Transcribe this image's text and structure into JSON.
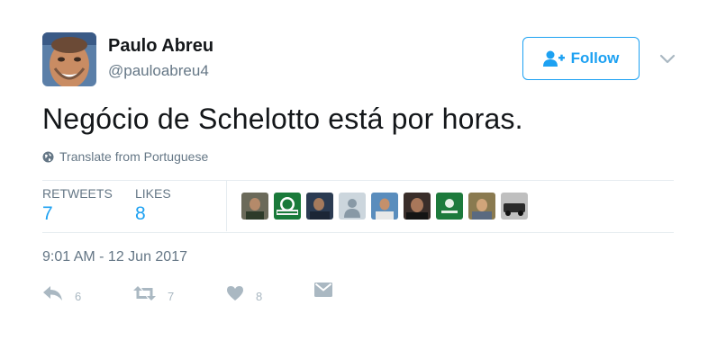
{
  "user": {
    "name": "Paulo Abreu",
    "handle": "@pauloabreu4"
  },
  "follow_button": {
    "label": "Follow"
  },
  "tweet": {
    "text": "Negócio de Schelotto está por horas.",
    "translate_label": "Translate from Portuguese",
    "timestamp": "9:01 AM - 12 Jun 2017"
  },
  "stats": {
    "retweets_label": "RETWEETS",
    "retweets_value": "7",
    "likes_label": "LIKES",
    "likes_value": "8"
  },
  "actions": {
    "reply_count": "6",
    "retweet_count": "7",
    "like_count": "8"
  },
  "colors": {
    "accent": "#1da1f2",
    "muted": "#657786",
    "icon": "#aab8c2"
  },
  "icons": [
    "add-user-icon",
    "chevron-down-icon",
    "globe-icon",
    "reply-icon",
    "retweet-icon",
    "heart-icon",
    "message-icon"
  ]
}
